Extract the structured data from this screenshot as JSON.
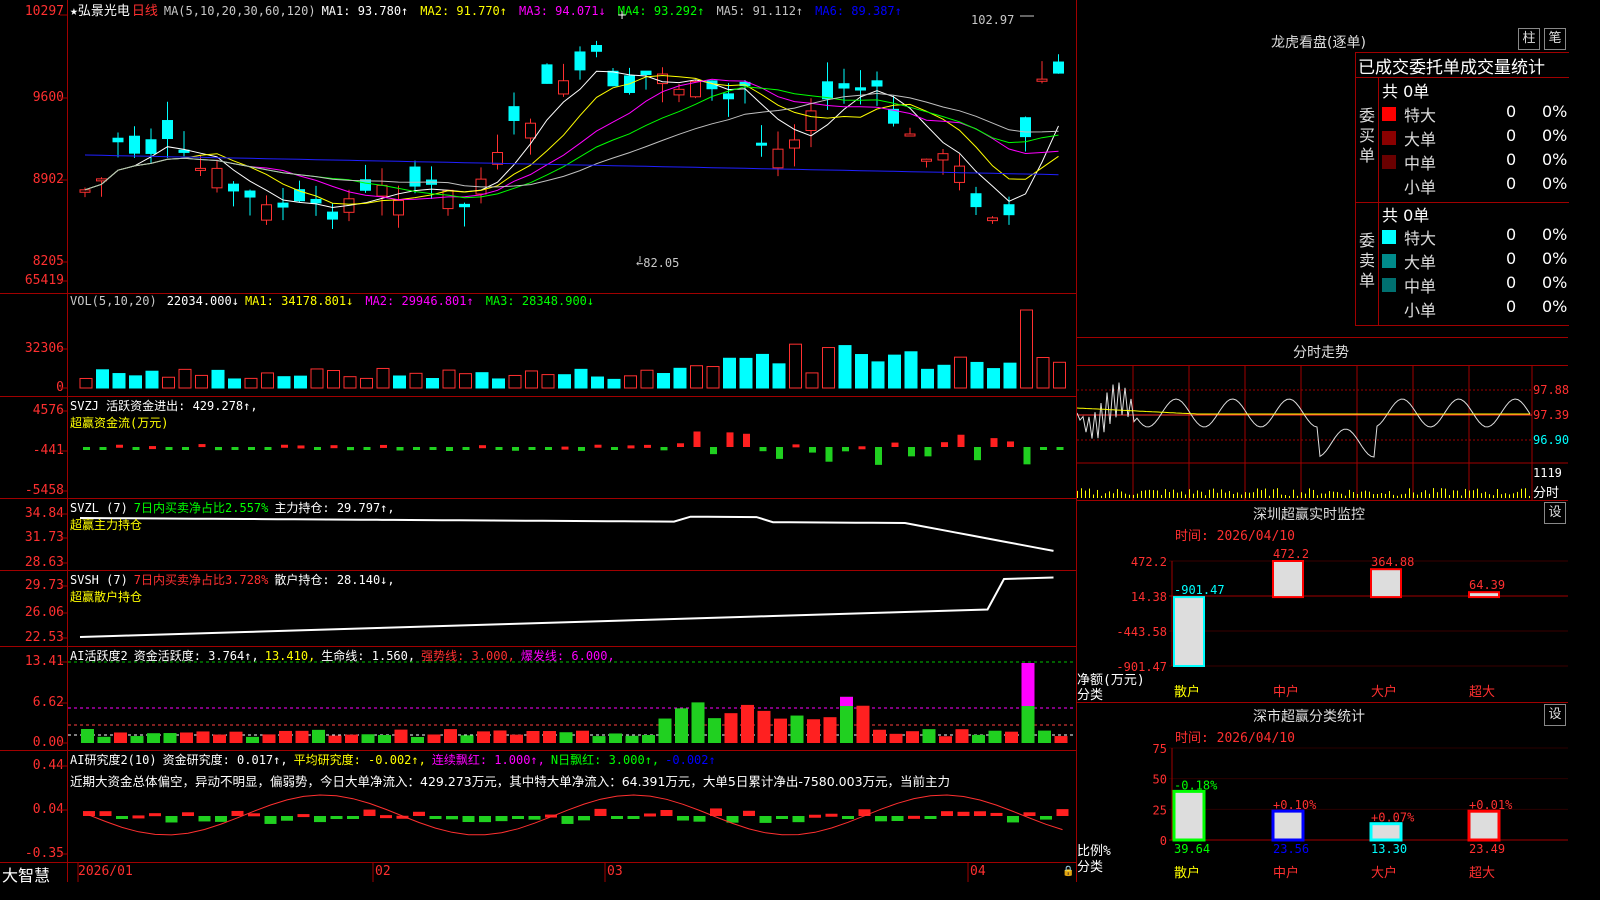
{
  "app": {
    "logo": "大智慧"
  },
  "main": {
    "title": "★弘景光电",
    "period": "日线",
    "ma_def": "MA(5,10,20,30,60,120)",
    "ma": [
      {
        "name": "MA1",
        "value": "93.780↑",
        "color": "#ffffff"
      },
      {
        "name": "MA2",
        "value": "91.770↑",
        "color": "#ffff00"
      },
      {
        "name": "MA3",
        "value": "94.071↓",
        "color": "#ff00ff"
      },
      {
        "name": "MA4",
        "value": "93.292↑",
        "color": "#00ff00"
      },
      {
        "name": "MA5",
        "value": "91.112↑",
        "color": "#c0c0c0"
      },
      {
        "name": "MA6",
        "value": "89.387↑",
        "color": "#0000ff"
      }
    ],
    "yticks": [
      "10297",
      "9600",
      "8902",
      "8205"
    ],
    "high_label": "102.97",
    "low_label": "←82.05"
  },
  "vol": {
    "def": "VOL(5,10,20)",
    "value": "22034.000↓",
    "ma": [
      {
        "name": "MA1",
        "value": "34178.801↓",
        "color": "#ffff00"
      },
      {
        "name": "MA2",
        "value": "29946.801↑",
        "color": "#ff00ff"
      },
      {
        "name": "MA3",
        "value": "28348.900↓",
        "color": "#00ff00"
      }
    ],
    "yticks": [
      "65419",
      "32306",
      "0"
    ]
  },
  "svzj": {
    "line1": "SVZJ  活跃资金进出: 429.278↑,",
    "line2": "超赢资金流(万元)",
    "yticks": [
      "4576",
      "-441",
      "-5458"
    ]
  },
  "svzl": {
    "name": "SVZL (7)",
    "desc": "7日内买卖净占比2.557%",
    "hold": "主力持仓: 29.797↑,",
    "line2": "超赢主力持仓",
    "yticks": [
      "34.84",
      "31.73",
      "28.63"
    ]
  },
  "svsh": {
    "name": "SVSH (7)",
    "desc": "7日内买卖净占比3.728%",
    "hold": "散户持仓: 28.140↓,",
    "line2": "超赢散户持仓",
    "yticks": [
      "29.73",
      "26.06",
      "22.53"
    ]
  },
  "ai1": {
    "name": "AI活跃度2",
    "act": "资金活跃度: 3.764↑,",
    "val2": "13.410,",
    "life": "生命线: 1.560,",
    "strong": "强势线: 3.000,",
    "burst": "爆发线: 6.000,",
    "yticks": [
      "13.41",
      "6.62",
      "0.00"
    ]
  },
  "ai2": {
    "name": "AI研究度2(10)",
    "res": "资金研究度: 0.017↑,",
    "avg": "平均研究度: -0.002↑,",
    "red1": "连续飘红: 1.000↑,",
    "red2": "N日飘红: 3.000↑,",
    "last": "-0.002↑",
    "comment": "近期大资金总体偏空，异动不明显，偏弱势，今日大单净流入：429.273万元，其中特大单净流入：64.391万元，大单5日累计净出-7580.003万元，当前主力",
    "yticks": [
      "0.44",
      "0.04",
      "-0.35"
    ]
  },
  "xaxis": [
    "2026/01",
    "02",
    "03",
    "04"
  ],
  "lhb": {
    "title": "龙虎看盘(逐单)",
    "btn1": "柱",
    "btn2": "笔",
    "subtitle": "已成交委托单成交量统计",
    "buy": {
      "side_label": "委买单",
      "total": "共 0单",
      "rows": [
        {
          "name": "特大",
          "count": "0",
          "pct": "0%",
          "color": "#ff0000"
        },
        {
          "name": "大单",
          "count": "0",
          "pct": "0%",
          "color": "#8b0000"
        },
        {
          "name": "中单",
          "count": "0",
          "pct": "0%",
          "color": "#6a0000"
        },
        {
          "name": "小单",
          "count": "0",
          "pct": "0%",
          "color": "#000000"
        }
      ]
    },
    "sell": {
      "side_label": "委卖单",
      "total": "共 0单",
      "rows": [
        {
          "name": "特大",
          "count": "0",
          "pct": "0%",
          "color": "#00ffff"
        },
        {
          "name": "大单",
          "count": "0",
          "pct": "0%",
          "color": "#008b8b"
        },
        {
          "name": "中单",
          "count": "0",
          "pct": "0%",
          "color": "#007070"
        },
        {
          "name": "小单",
          "count": "0",
          "pct": "0%",
          "color": "#000000"
        }
      ]
    }
  },
  "intraday": {
    "title": "分时走势",
    "yticks": [
      "97.88",
      "97.39",
      "96.90"
    ],
    "vol_tick": "1119",
    "vol_label": "分时"
  },
  "monitor": {
    "title": "深圳超赢实时监控",
    "btn": "设",
    "time": "时间: 2026/04/10",
    "yticks": [
      "472.2",
      "14.38",
      "-443.58",
      "-901.47"
    ],
    "ylabel": "净额(万元)",
    "xlabel": "分类",
    "chart_data": {
      "type": "bar",
      "categories": [
        "散户",
        "中户",
        "大户",
        "超大"
      ],
      "values": [
        -901.47,
        472.2,
        364.88,
        64.39
      ],
      "value_labels": [
        "-901.47",
        "472.2",
        "364.88",
        "64.39"
      ],
      "ylim": [
        -901.47,
        472.2
      ],
      "colors": [
        "#00ffff",
        "#ff0000",
        "#ff0000",
        "#ff0000"
      ]
    }
  },
  "classify": {
    "title": "深市超赢分类统计",
    "btn": "设",
    "time": "时间: 2026/04/10",
    "yticks": [
      "75",
      "50",
      "25",
      "0"
    ],
    "ylabel": "比例%",
    "xlabel": "分类",
    "chart_data": {
      "type": "bar",
      "categories": [
        "散户",
        "中户",
        "大户",
        "超大"
      ],
      "values": [
        39.64,
        23.56,
        13.3,
        23.49
      ],
      "value_labels": [
        "39.64",
        "23.56",
        "13.30",
        "23.49"
      ],
      "change_labels": [
        "-0.18%",
        "+0.10%",
        "+0.07%",
        "+0.01%"
      ],
      "ylim": [
        0,
        75
      ],
      "colors": [
        "#00ff00",
        "#0000ff",
        "#00ffff",
        "#ff0000"
      ]
    }
  }
}
